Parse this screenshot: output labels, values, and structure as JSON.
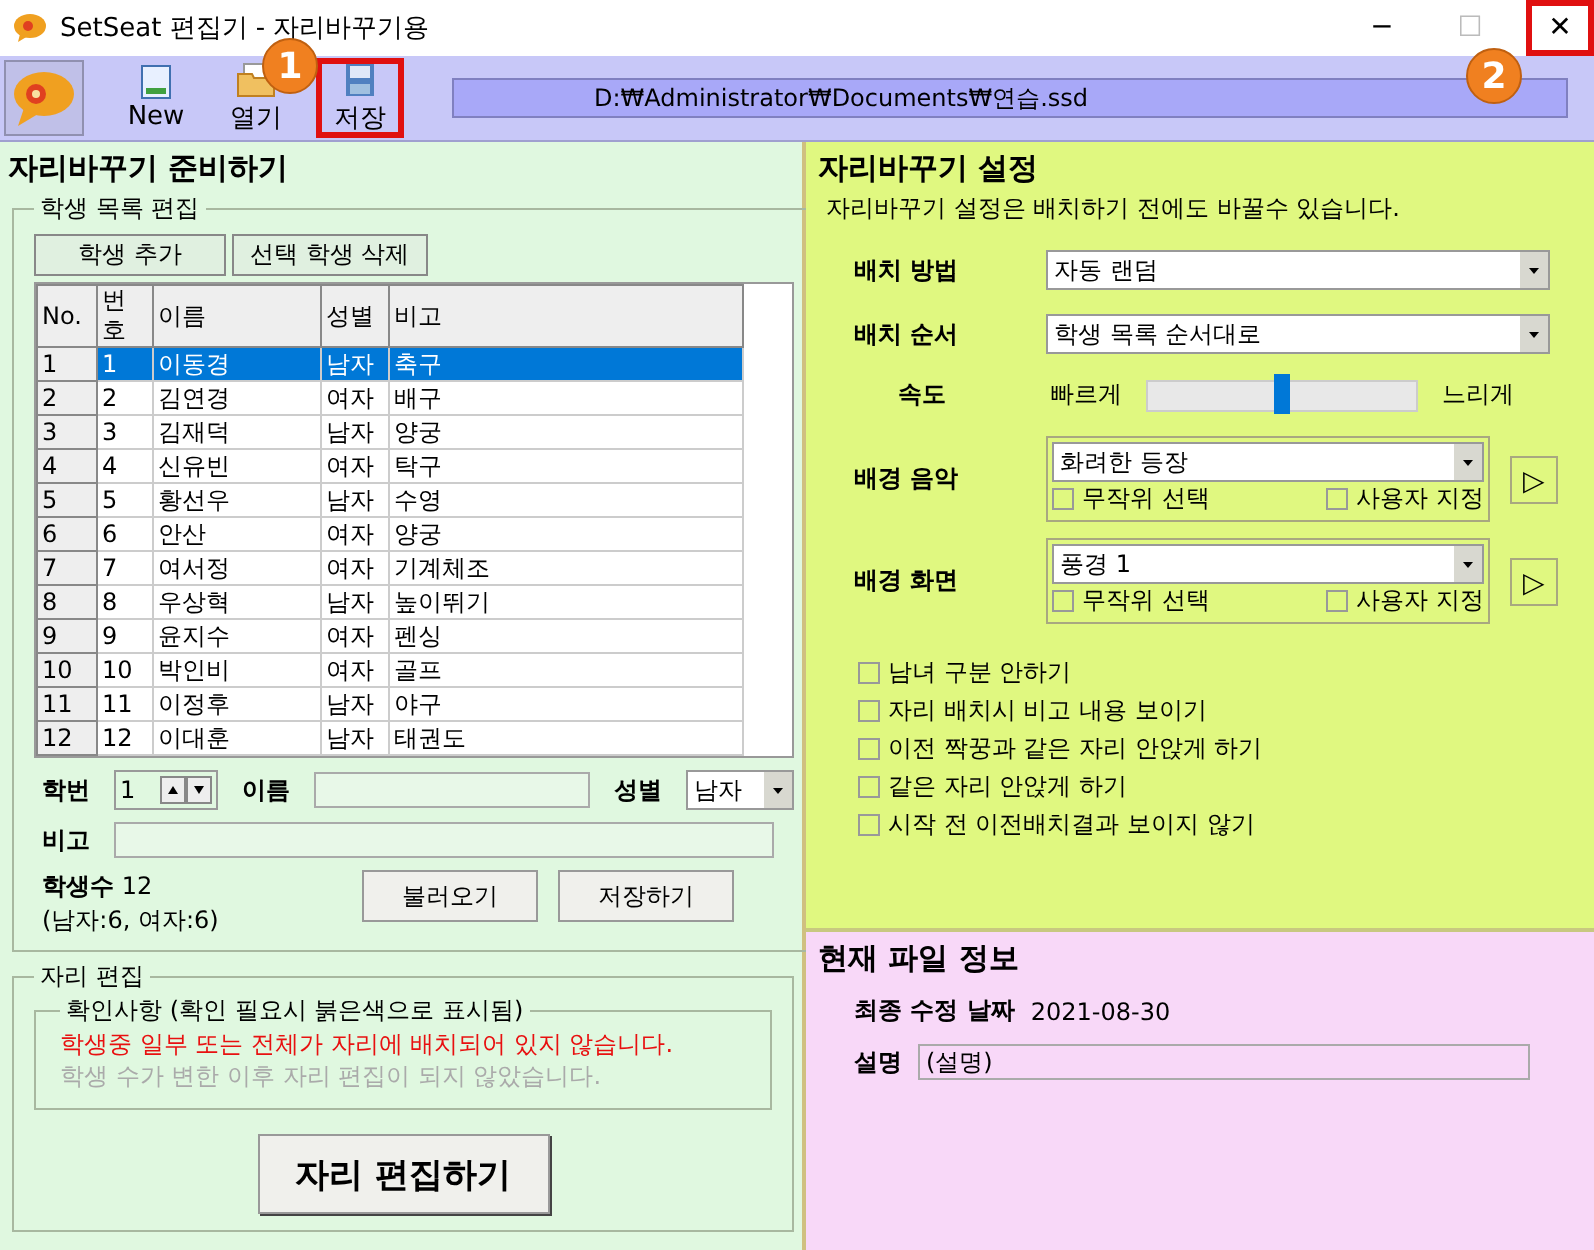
{
  "window": {
    "title": "SetSeat 편집기 - 자리바꾸기용",
    "controls": [
      {
        "kind": "minimize",
        "label": "─",
        "highlighted": false
      },
      {
        "kind": "maximize",
        "label": "☐",
        "highlighted": false
      },
      {
        "kind": "close",
        "label": "✕",
        "highlighted": true
      }
    ]
  },
  "toolbar": {
    "buttons": [
      {
        "kind": "new",
        "label": "New",
        "highlighted": false
      },
      {
        "kind": "open",
        "label": "열기",
        "highlighted": false
      },
      {
        "kind": "save",
        "label": "저장",
        "highlighted": true
      }
    ],
    "path": "D:₩Administrator₩Documents₩연습.ssd"
  },
  "annotations": [
    "1",
    "2"
  ],
  "prepare": {
    "title": "자리바꾸기 준비하기",
    "list_group": "학생 목록 편집",
    "buttons": [
      "학생 추가",
      "선택 학생 삭제"
    ],
    "table": {
      "columns": [
        "No.",
        "번호",
        "이름",
        "성별",
        "비고"
      ],
      "rows": [
        {
          "cells": [
            "1",
            "1",
            "이동경",
            "남자",
            "축구"
          ],
          "selected": true
        },
        {
          "cells": [
            "2",
            "2",
            "김연경",
            "여자",
            "배구"
          ],
          "selected": false
        },
        {
          "cells": [
            "3",
            "3",
            "김재덕",
            "남자",
            "양궁"
          ],
          "selected": false
        },
        {
          "cells": [
            "4",
            "4",
            "신유빈",
            "여자",
            "탁구"
          ],
          "selected": false
        },
        {
          "cells": [
            "5",
            "5",
            "황선우",
            "남자",
            "수영"
          ],
          "selected": false
        },
        {
          "cells": [
            "6",
            "6",
            "안산",
            "여자",
            "양궁"
          ],
          "selected": false
        },
        {
          "cells": [
            "7",
            "7",
            "여서정",
            "여자",
            "기계체조"
          ],
          "selected": false
        },
        {
          "cells": [
            "8",
            "8",
            "우상혁",
            "남자",
            "높이뛰기"
          ],
          "selected": false
        },
        {
          "cells": [
            "9",
            "9",
            "윤지수",
            "여자",
            "펜싱"
          ],
          "selected": false
        },
        {
          "cells": [
            "10",
            "10",
            "박인비",
            "여자",
            "골프"
          ],
          "selected": false
        },
        {
          "cells": [
            "11",
            "11",
            "이정후",
            "남자",
            "야구"
          ],
          "selected": false
        },
        {
          "cells": [
            "12",
            "12",
            "이대훈",
            "남자",
            "태권도"
          ],
          "selected": false
        }
      ]
    },
    "form": {
      "number_label": "학번",
      "number_value": "1",
      "name_label": "이름",
      "gender_label": "성별",
      "gender_value": "남자",
      "note_label": "비고"
    },
    "count_label": "학생수",
    "count_value": "12",
    "count_detail": "(남자:6, 여자:6)",
    "actions": [
      "불러오기",
      "저장하기"
    ],
    "seat_group": "자리 편집",
    "check_group": "확인사항 (확인 필요시 붉은색으로 표시됨)",
    "messages": [
      {
        "text": "학생중 일부 또는 전체가 자리에 배치되어 있지 않습니다.",
        "warning": true
      },
      {
        "text": "학생 수가 변한 이후 자리 편집이 되지 않았습니다.",
        "warning": false
      }
    ],
    "edit_button": "자리 편집하기"
  },
  "settings": {
    "title": "자리바꾸기 설정",
    "note": "자리바꾸기 설정은 배치하기 전에도 바꿀수 있습니다.",
    "method": {
      "label": "배치 방법",
      "value": "자동 랜덤"
    },
    "order": {
      "label": "배치 순서",
      "value": "학생 목록 순서대로"
    },
    "speed": {
      "label": "속도",
      "fast": "빠르게",
      "slow": "느리게",
      "level": 0.5
    },
    "media": [
      {
        "label": "배경 음악",
        "value": "화려한 등장",
        "random": {
          "label": "무작위 선택",
          "checked": false
        },
        "custom": {
          "label": "사용자 지정",
          "checked": false
        },
        "play": "▷"
      },
      {
        "label": "배경 화면",
        "value": "풍경 1",
        "random": {
          "label": "무작위 선택",
          "checked": false
        },
        "custom": {
          "label": "사용자 지정",
          "checked": false
        },
        "play": "▷"
      }
    ],
    "options": [
      {
        "label": "남녀 구분 안하기",
        "checked": false
      },
      {
        "label": "자리 배치시 비고 내용 보이기",
        "checked": false
      },
      {
        "label": "이전 짝꿍과 같은 자리 안앉게 하기",
        "checked": false
      },
      {
        "label": "같은 자리 안앉게 하기",
        "checked": false
      },
      {
        "label": "시작 전 이전배치결과 보이지 않기",
        "checked": false
      }
    ]
  },
  "file_info": {
    "title": "현재 파일 정보",
    "date_label": "최종 수정 날짜",
    "date_value": "2021-08-30",
    "desc_label": "설명",
    "desc_value": "(설명)"
  }
}
